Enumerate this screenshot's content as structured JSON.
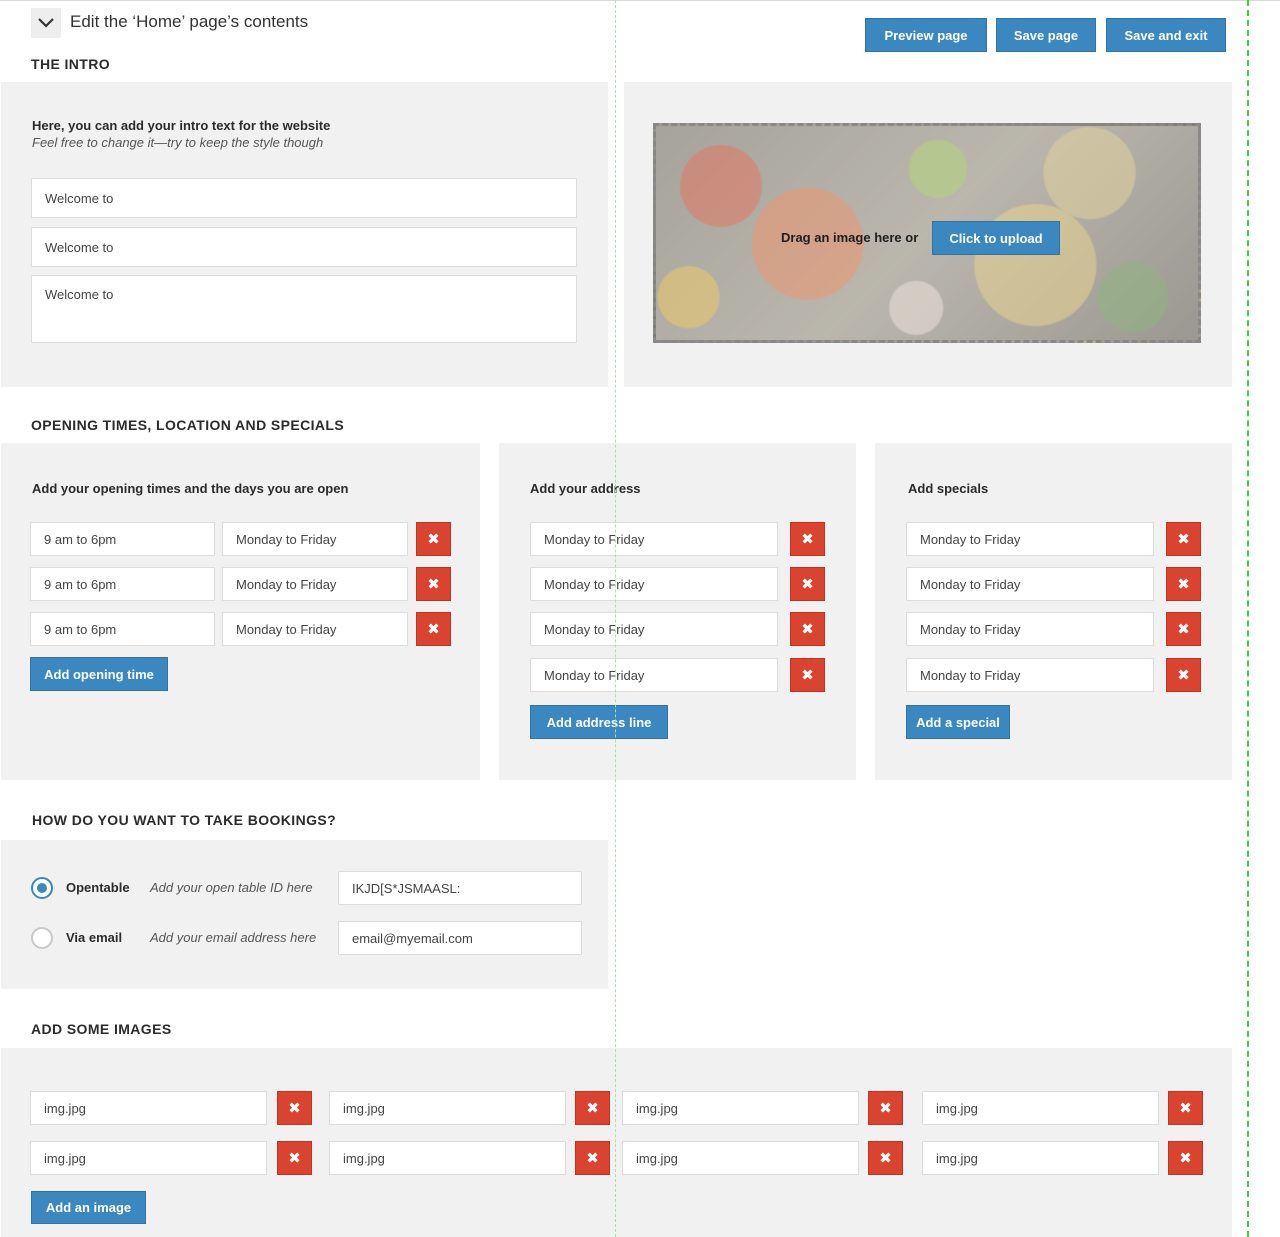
{
  "header": {
    "title": "Edit the ‘Home’ page’s contents",
    "preview_label": "Preview page",
    "save_label": "Save page",
    "save_exit_label": "Save and exit"
  },
  "intro": {
    "section_title": "THE INTRO",
    "heading": "Here, you can add your intro text for the website",
    "subheading": "Feel free to change it—try to keep the style though",
    "fields": [
      "Welcome to",
      "Welcome to",
      "Welcome to"
    ],
    "dropzone_text": "Drag an image here or",
    "upload_label": "Click to upload"
  },
  "opening": {
    "section_title": "OPENING TIMES, LOCATION AND SPECIALS",
    "times": {
      "heading": "Add your opening times and the days you are open",
      "rows": [
        {
          "time": "9 am to 6pm",
          "days": "Monday to Friday"
        },
        {
          "time": "9 am to 6pm",
          "days": "Monday to Friday"
        },
        {
          "time": "9 am to 6pm",
          "days": "Monday to Friday"
        }
      ],
      "add_label": "Add opening time"
    },
    "address": {
      "heading": "Add your address",
      "lines": [
        "Monday to Friday",
        "Monday to Friday",
        "Monday to Friday",
        "Monday to Friday"
      ],
      "add_label": "Add address line"
    },
    "specials": {
      "heading": "Add specials",
      "lines": [
        "Monday to Friday",
        "Monday to Friday",
        "Monday to Friday",
        "Monday to Friday"
      ],
      "add_label": "Add a special"
    }
  },
  "bookings": {
    "section_title": "HOW DO YOU WANT TO TAKE BOOKINGS?",
    "options": [
      {
        "label": "Opentable",
        "hint": "Add your open table ID here",
        "value": "IKJD[S*JSMAASL:",
        "selected": true
      },
      {
        "label": "Via email",
        "hint": "Add your email address here",
        "value": "email@myemail.com",
        "selected": false
      }
    ]
  },
  "images": {
    "section_title": "ADD SOME IMAGES",
    "files": [
      "img.jpg",
      "img.jpg",
      "img.jpg",
      "img.jpg",
      "img.jpg",
      "img.jpg",
      "img.jpg",
      "img.jpg"
    ],
    "add_label": "Add an image"
  },
  "icons": {
    "delete": "close-icon",
    "collapse": "chevron-down-icon"
  },
  "colors": {
    "primary": "#3a88bf",
    "danger": "#d9432f",
    "panel": "#f1f1f1",
    "guide_light": "#9ee89e",
    "guide_strong": "#3fcf3f"
  }
}
